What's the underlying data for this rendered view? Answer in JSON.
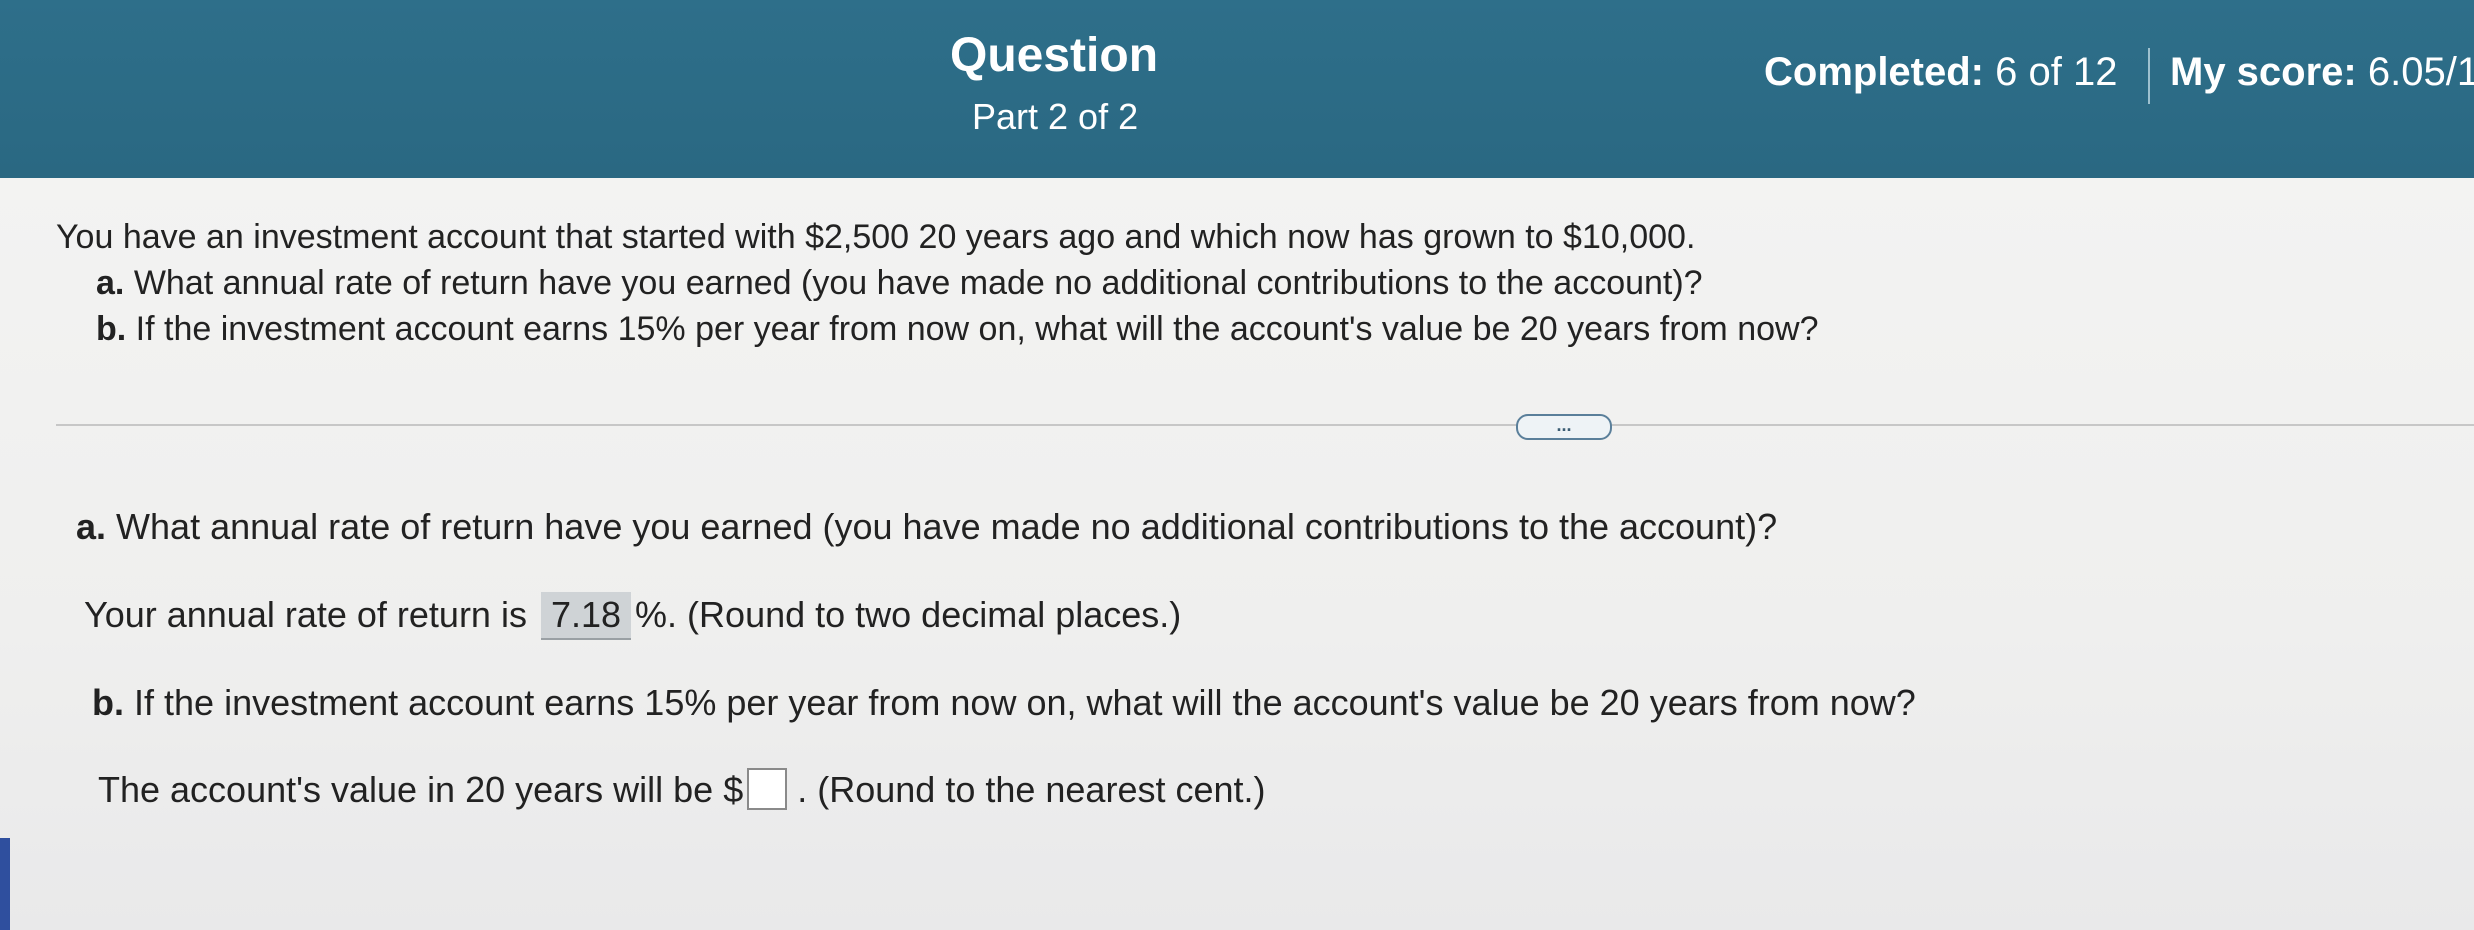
{
  "header": {
    "title": "Question",
    "part": "Part 2 of 2",
    "completed_label": "Completed:",
    "completed_value": "6 of 12",
    "score_label": "My score:",
    "score_value": "6.05/1"
  },
  "problem": {
    "intro": "You have an investment account that started with $2,500 20 years ago and which now has grown to $10,000.",
    "a_letter": "a.",
    "a_text": "What annual rate of return have you earned (you have made no additional contributions to the account)?",
    "b_letter": "b.",
    "b_text": "If the investment account earns 15% per year from now on, what will the account's value be 20 years from now?"
  },
  "more_button": "...",
  "part_a": {
    "letter": "a.",
    "question": "What annual rate of return have you earned (you have made no additional contributions to the account)?",
    "answer_prefix": "Your annual rate of return is",
    "answer_value": "7.18",
    "answer_suffix": "%.  (Round to two decimal places.)"
  },
  "part_b": {
    "letter": "b.",
    "question": "If the investment account earns 15% per year from now on, what will the account's value be 20 years from now?",
    "answer_prefix": "The account's value in 20 years will be $",
    "answer_value": "",
    "answer_suffix": ".  (Round to the nearest cent.)"
  }
}
